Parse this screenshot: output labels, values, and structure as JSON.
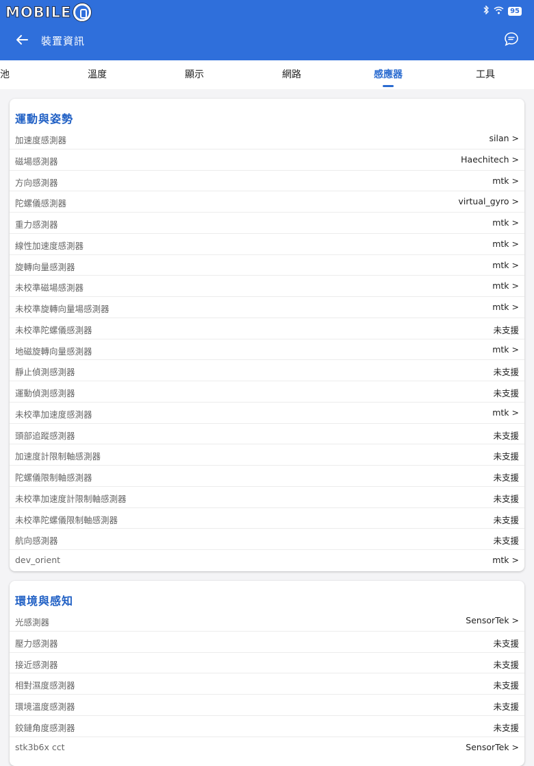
{
  "watermark": {
    "text": "MOBILE",
    "suffix": "01"
  },
  "status": {
    "battery": "95"
  },
  "header": {
    "title": "裝置資訊"
  },
  "tabs": [
    {
      "label": "池"
    },
    {
      "label": "溫度"
    },
    {
      "label": "顯示"
    },
    {
      "label": "網路"
    },
    {
      "label": "感應器",
      "active": true
    },
    {
      "label": "工具"
    }
  ],
  "colors": {
    "appbar": "#2f6fdb",
    "accent": "#2a6bd0"
  },
  "sections": [
    {
      "title": "運動與姿勢",
      "rows": [
        {
          "label": "加速度感測器",
          "value": "silan >"
        },
        {
          "label": "磁場感測器",
          "value": "Haechitech >"
        },
        {
          "label": "方向感測器",
          "value": "mtk >"
        },
        {
          "label": "陀螺儀感測器",
          "value": "virtual_gyro >"
        },
        {
          "label": "重力感測器",
          "value": "mtk >"
        },
        {
          "label": "線性加速度感測器",
          "value": "mtk >"
        },
        {
          "label": "旋轉向量感測器",
          "value": "mtk >"
        },
        {
          "label": "未校準磁場感測器",
          "value": "mtk >"
        },
        {
          "label": "未校準旋轉向量場感測器",
          "value": "mtk >"
        },
        {
          "label": "未校準陀螺儀感測器",
          "value": "未支援"
        },
        {
          "label": "地磁旋轉向量感測器",
          "value": "mtk >"
        },
        {
          "label": "靜止偵測感測器",
          "value": "未支援"
        },
        {
          "label": "運動偵測感測器",
          "value": "未支援"
        },
        {
          "label": "未校準加速度感測器",
          "value": "mtk >"
        },
        {
          "label": "頭部追蹤感測器",
          "value": "未支援"
        },
        {
          "label": "加速度計限制軸感測器",
          "value": "未支援"
        },
        {
          "label": "陀螺儀限制軸感測器",
          "value": "未支援"
        },
        {
          "label": "未校準加速度計限制軸感測器",
          "value": "未支援"
        },
        {
          "label": "未校準陀螺儀限制軸感測器",
          "value": "未支援"
        },
        {
          "label": "航向感測器",
          "value": "未支援"
        },
        {
          "label": "dev_orient",
          "value": "mtk >"
        }
      ]
    },
    {
      "title": "環境與感知",
      "rows": [
        {
          "label": "光感測器",
          "value": "SensorTek >"
        },
        {
          "label": "壓力感測器",
          "value": "未支援"
        },
        {
          "label": "接近感測器",
          "value": "未支援"
        },
        {
          "label": "相對濕度感測器",
          "value": "未支援"
        },
        {
          "label": "環境溫度感測器",
          "value": "未支援"
        },
        {
          "label": "鉸鏈角度感測器",
          "value": "未支援"
        },
        {
          "label": "stk3b6x cct",
          "value": "SensorTek >"
        }
      ]
    }
  ]
}
